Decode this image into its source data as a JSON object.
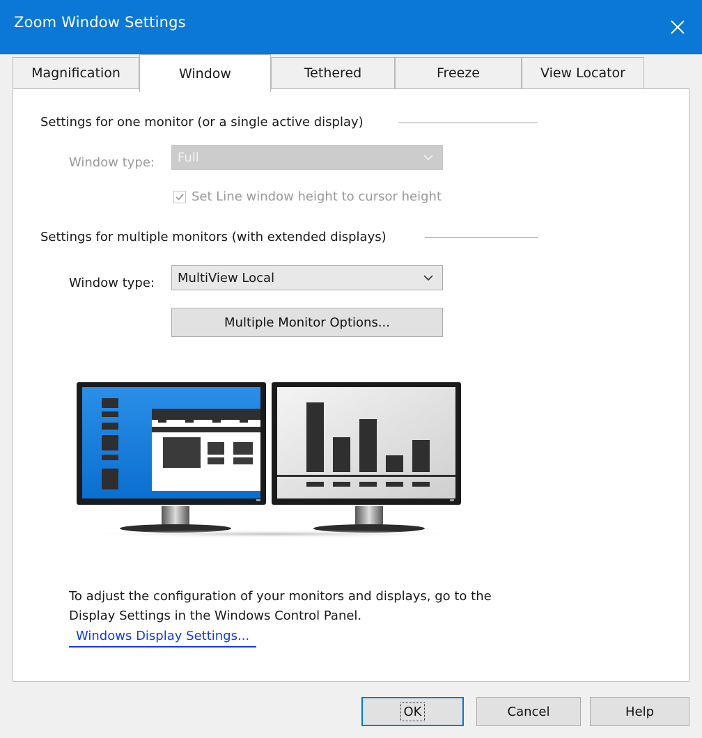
{
  "window": {
    "title": "Zoom Window Settings"
  },
  "tabs": [
    {
      "label": "Magnification"
    },
    {
      "label": "Window"
    },
    {
      "label": "Tethered"
    },
    {
      "label": "Freeze"
    },
    {
      "label": "View Locator"
    }
  ],
  "single_monitor": {
    "heading": "Settings for one monitor (or a single active display)",
    "window_type_label": "Window type:",
    "window_type_value": "Full",
    "checkbox_label": "Set Line window height to cursor height",
    "checkbox_checked": true
  },
  "multi_monitor": {
    "heading": "Settings for multiple monitors (with extended displays)",
    "window_type_label": "Window type:",
    "window_type_value": "MultiView Local",
    "options_button": "Multiple Monitor Options..."
  },
  "info": {
    "text": "To adjust the configuration of your monitors and displays, go to the Display Settings in the Windows Control Panel.",
    "link": "Windows Display Settings..."
  },
  "footer": {
    "ok": "OK",
    "cancel": "Cancel",
    "help": "Help"
  },
  "colors": {
    "titlebar": "#0b78d7",
    "screen_blue": "#0a7bd8",
    "link": "#0a3cf0"
  }
}
